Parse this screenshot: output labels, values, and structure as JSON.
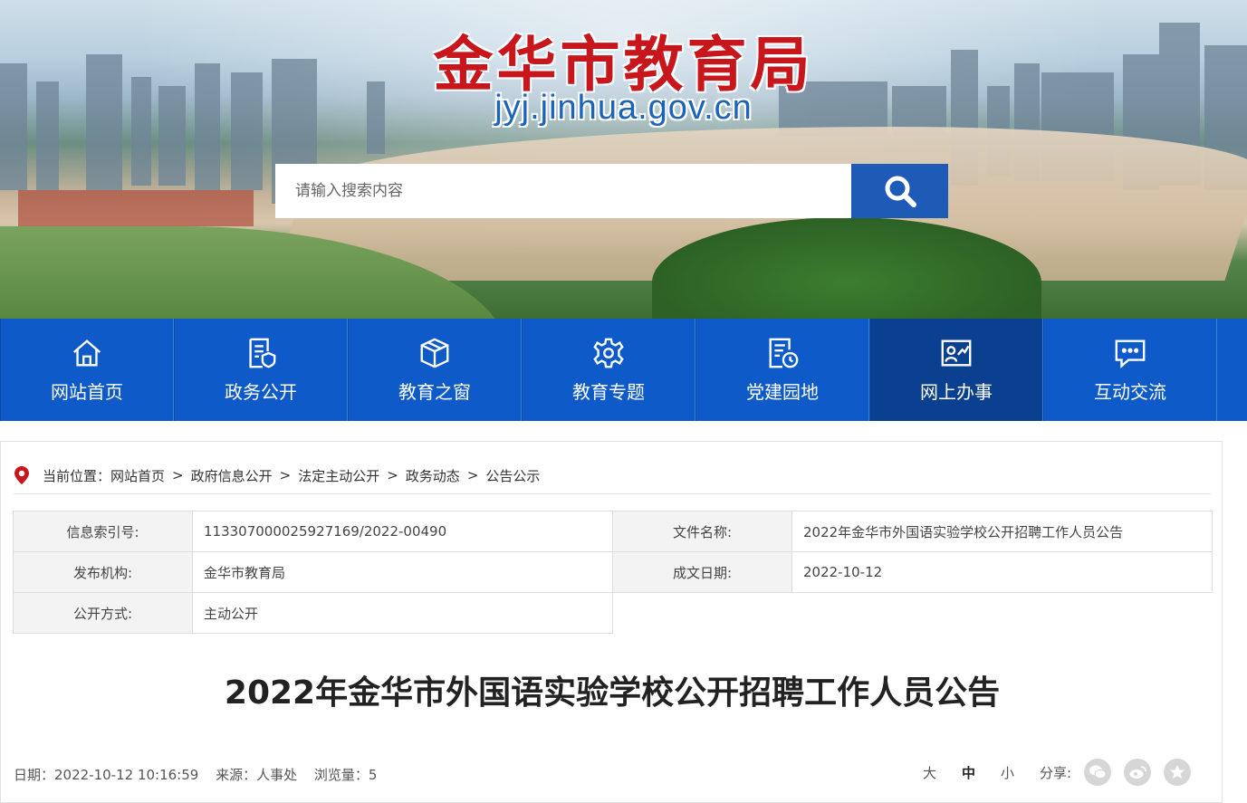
{
  "header": {
    "site_title": "金华市教育局",
    "site_domain": "jyj.jinhua.gov.cn",
    "search": {
      "placeholder": "请输入搜索内容",
      "value": ""
    }
  },
  "nav": {
    "items": [
      {
        "label": "网站首页",
        "icon": "home-icon"
      },
      {
        "label": "政务公开",
        "icon": "document-shield-icon"
      },
      {
        "label": "教育之窗",
        "icon": "cube-icon"
      },
      {
        "label": "教育专题",
        "icon": "gear-icon"
      },
      {
        "label": "党建园地",
        "icon": "document-clock-icon"
      },
      {
        "label": "网上办事",
        "icon": "user-chart-icon",
        "active": true
      },
      {
        "label": "互动交流",
        "icon": "chat-icon"
      }
    ]
  },
  "breadcrumb": {
    "prefix": "当前位置：",
    "items": [
      "网站首页",
      "政府信息公开",
      "法定主动公开",
      "政务动态",
      "公告公示"
    ],
    "separator": ">"
  },
  "info_table": {
    "index_label": "信息索引号:",
    "index_value": "113307000025927169/2022-00490",
    "filename_label": "文件名称:",
    "filename_value": "2022年金华市外国语实验学校公开招聘工作人员公告",
    "publisher_label": "发布机构:",
    "publisher_value": "金华市教育局",
    "date_label": "成文日期:",
    "date_value": "2022-10-12",
    "method_label": "公开方式:",
    "method_value": "主动公开"
  },
  "article": {
    "title": "2022年金华市外国语实验学校公开招聘工作人员公告",
    "date_text": "日期：2022-10-12 10:16:59",
    "source_text": "来源：人事处",
    "views_text": "浏览量：5"
  },
  "tools": {
    "font_large": "大",
    "font_medium": "中",
    "font_small": "小",
    "share_label": "分享:",
    "share_icons": [
      "wechat-icon",
      "weibo-icon",
      "favorite-star-icon"
    ]
  },
  "colors": {
    "brand_red": "#c8161d",
    "nav_blue": "#0d5ac8",
    "nav_active": "#0b3f8f",
    "search_blue": "#1e5bb7"
  }
}
